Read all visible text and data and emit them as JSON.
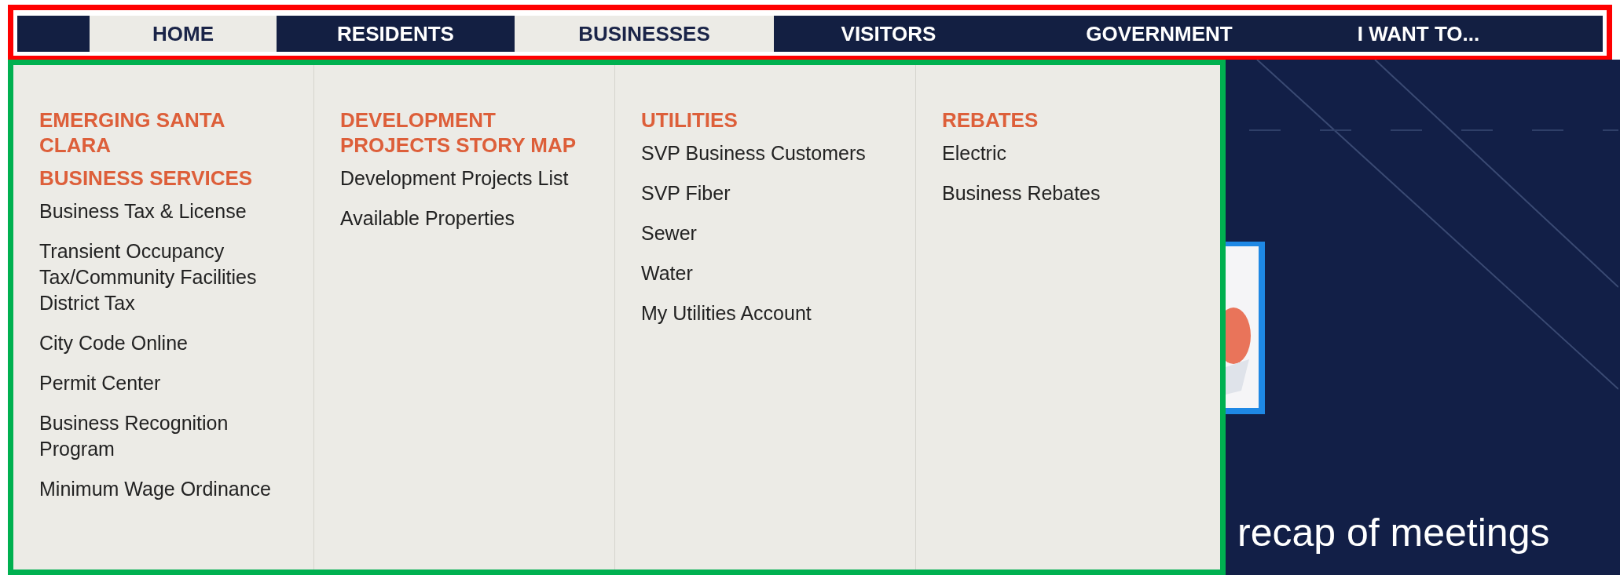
{
  "nav": {
    "tabs": [
      {
        "label": "HOME",
        "highlighted": true
      },
      {
        "label": "RESIDENTS",
        "highlighted": false
      },
      {
        "label": "BUSINESSES",
        "highlighted": true
      },
      {
        "label": "VISITORS",
        "highlighted": false
      },
      {
        "label": "GOVERNMENT",
        "highlighted": false
      },
      {
        "label": "I WANT TO...",
        "highlighted": false
      }
    ]
  },
  "menu": {
    "columns": [
      {
        "entries": [
          {
            "kind": "heading",
            "label": "EMERGING SANTA CLARA"
          },
          {
            "kind": "heading",
            "label": "BUSINESS SERVICES"
          },
          {
            "kind": "link",
            "label": "Business Tax & License"
          },
          {
            "kind": "link",
            "label": "Transient Occupancy Tax/Community Facilities District Tax"
          },
          {
            "kind": "link",
            "label": "City Code Online"
          },
          {
            "kind": "link",
            "label": "Permit Center"
          },
          {
            "kind": "link",
            "label": "Business Recognition Program"
          },
          {
            "kind": "link",
            "label": "Minimum Wage Ordinance"
          }
        ]
      },
      {
        "entries": [
          {
            "kind": "heading",
            "label": "DEVELOPMENT PROJECTS STORY MAP"
          },
          {
            "kind": "link",
            "label": "Development Projects List"
          },
          {
            "kind": "link",
            "label": "Available Properties"
          }
        ]
      },
      {
        "entries": [
          {
            "kind": "heading",
            "label": "UTILITIES"
          },
          {
            "kind": "link",
            "label": "SVP Business Customers"
          },
          {
            "kind": "link",
            "label": "SVP Fiber"
          },
          {
            "kind": "link",
            "label": "Sewer"
          },
          {
            "kind": "link",
            "label": "Water"
          },
          {
            "kind": "link",
            "label": "My Utilities Account"
          }
        ]
      },
      {
        "entries": [
          {
            "kind": "heading",
            "label": "REBATES"
          },
          {
            "kind": "link",
            "label": "Electric"
          },
          {
            "kind": "link",
            "label": "Business Rebates"
          }
        ]
      }
    ]
  },
  "hero": {
    "caption": "recap of meetings"
  }
}
